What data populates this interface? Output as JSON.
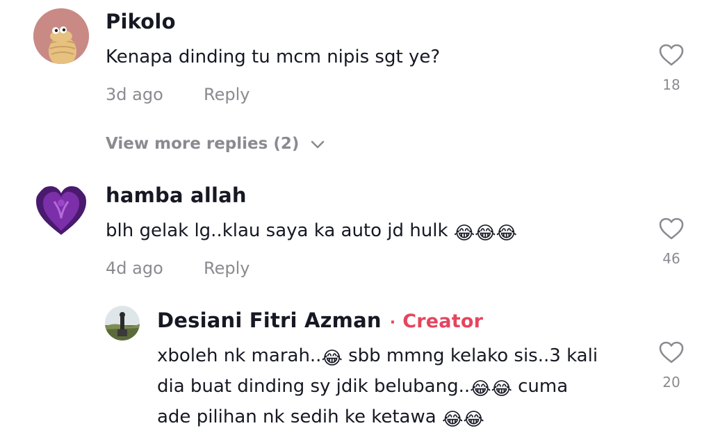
{
  "comments": [
    {
      "username": "Pikolo",
      "text": "Kenapa dinding tu mcm nipis sgt ye?",
      "time": "3d ago",
      "reply_label": "Reply",
      "likes": "18",
      "view_more": "View more replies (2)"
    },
    {
      "username": "hamba allah",
      "text": "blh gelak lg..klau saya ka auto jd hulk",
      "emoji": "😂😂😂",
      "time": "4d ago",
      "reply_label": "Reply",
      "likes": "46"
    }
  ],
  "reply": {
    "username": "Desiani Fitri Azman",
    "separator": "·",
    "badge": "Creator",
    "line1_a": "xboleh nk marah..",
    "line1_emoji": "😂",
    "line1_b": " sbb mmng kelako sis..3 kali",
    "line2_a": "dia buat dinding sy jdik belubang..",
    "line2_emoji": "😂😂",
    "line2_b": " cuma",
    "line3_a": "ade pilihan nk sedih ke ketawa ",
    "line3_emoji": "😂😂",
    "likes": "20"
  },
  "icons": {
    "like": "heart-outline-icon",
    "expand": "chevron-down-icon",
    "emoji": "tears-of-joy-emoji"
  },
  "colors": {
    "text": "#161823",
    "secondary": "#8a8b91",
    "creator": "#e5455f"
  }
}
